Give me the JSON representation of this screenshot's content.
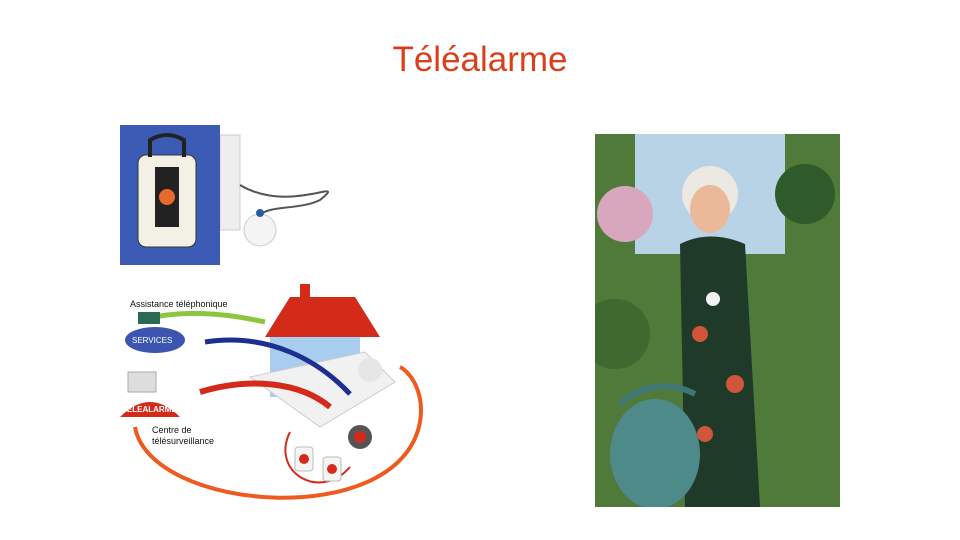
{
  "slide": {
    "title": "Téléalarme",
    "title_color": "#d9401a"
  },
  "diagram": {
    "assistance_label": "Assistance téléphonique",
    "services_label": "SERVICES",
    "telealarme_label": "TELEALARME",
    "centre_label_line1": "Centre de",
    "centre_label_line2": "télésurveillance"
  }
}
